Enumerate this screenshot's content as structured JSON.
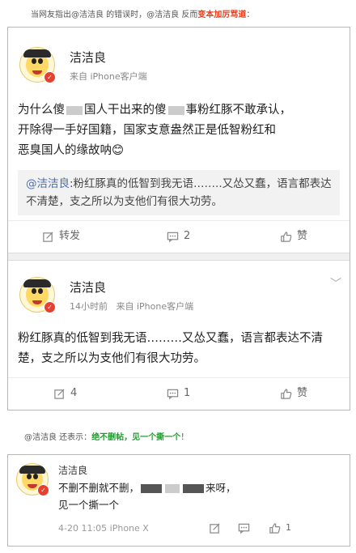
{
  "captions": {
    "top_prefix": "当网友指出@洁洁良 的错误时，@洁洁良 反而",
    "top_highlight": "变本加厉骂道",
    "top_suffix": "：",
    "bottom_prefix": "@洁洁良 还表示：",
    "bottom_highlight": "绝不删帖，见一个撕一个",
    "bottom_suffix": "！"
  },
  "post1": {
    "name": "洁洁良",
    "meta": "来自 iPhone客户端",
    "text_line1a": "为什么傻",
    "text_line1b": "国人干出来的傻",
    "text_line1c": "事粉红豚不敢承认，",
    "text_line2": "开除得一手好国籍，国家支意盎然正是低智粉红和",
    "text_line3": "恶臭国人的缘故呐😊",
    "quote_at": "@洁洁良",
    "quote_text": ":粉红豚真的低智到我无语……..又怂又蠢，语言都表达不清楚，支之所以为支他们有很大功劳。",
    "repost_label": "转发",
    "comment_count": "2",
    "like_label": "赞"
  },
  "post2": {
    "name": "洁洁良",
    "meta_time": "14小时前",
    "meta_source": "来自 iPhone客户端",
    "text": "粉红豚真的低智到我无语………又怂又蠢，语言都表达不清楚，支之所以为支他们有很大功劳。",
    "repost_count": "4",
    "comment_count": "1",
    "like_label": "赞"
  },
  "post3": {
    "name": "洁洁良",
    "text_a": "不删不删就不删，",
    "text_b": "来呀，",
    "text_line2": "见一个撕一个",
    "meta": "4-20 11:05 iPhone X",
    "like_count": "1"
  }
}
